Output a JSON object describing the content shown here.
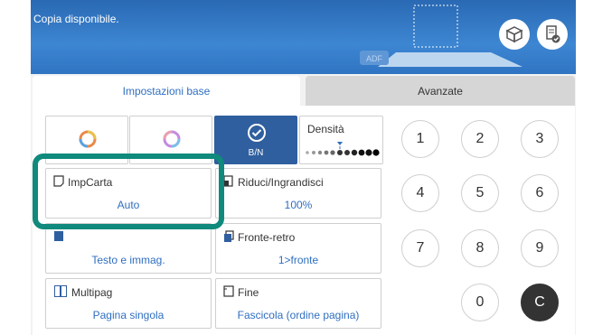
{
  "status": {
    "text": "Copia disponibile."
  },
  "scanner": {
    "adf_label": "ADF"
  },
  "tabs": [
    {
      "label": "Impostazioni base"
    },
    {
      "label": "Avanzate"
    }
  ],
  "color_modes": [
    {
      "name": "color"
    },
    {
      "name": "color-alt"
    },
    {
      "name": "B/N",
      "label": "B/N",
      "selected": true
    }
  ],
  "density": {
    "label": "Densità"
  },
  "settings": {
    "paper": {
      "label": "ImpCarta",
      "value": "Auto"
    },
    "reduce": {
      "label": "Riduci/Ingrandisci",
      "value": "100%"
    },
    "original": {
      "label": "",
      "value": "Testo e immag."
    },
    "duplex": {
      "label": "Fronte-retro",
      "value": "1>fronte"
    },
    "multipage": {
      "label": "Multipag",
      "value": "Pagina singola"
    },
    "finish": {
      "label": "Fine",
      "value": "Fascicola (ordine pagina)"
    }
  },
  "keypad": [
    "1",
    "2",
    "3",
    "4",
    "5",
    "6",
    "7",
    "8",
    "9",
    "0",
    "C"
  ],
  "colors": {
    "accent": "#2f6fc0",
    "highlight": "#0f8a7c",
    "header": "#3d86d2"
  }
}
